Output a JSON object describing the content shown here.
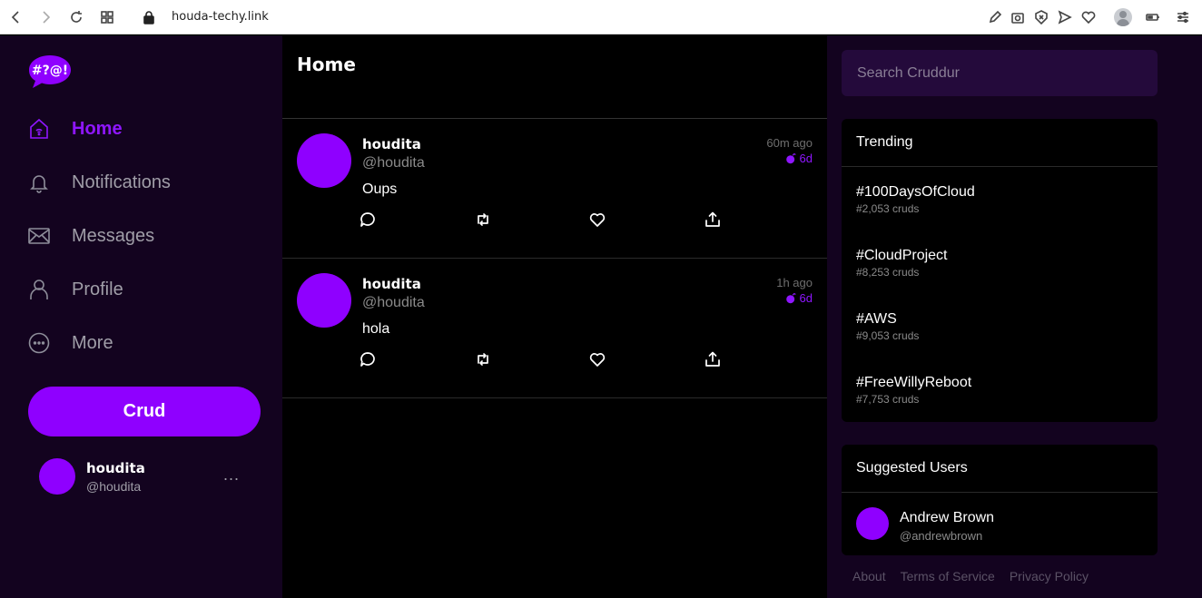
{
  "browser": {
    "url": "houda-techy.link"
  },
  "brand": {
    "logo_text": "#?@!",
    "accent": "#8f00ff"
  },
  "nav": {
    "items": [
      {
        "label": "Home",
        "icon": "home-icon",
        "active": true
      },
      {
        "label": "Notifications",
        "icon": "bell-icon"
      },
      {
        "label": "Messages",
        "icon": "envelope-icon"
      },
      {
        "label": "Profile",
        "icon": "user-icon"
      },
      {
        "label": "More",
        "icon": "more-circle-icon"
      }
    ],
    "crud_button": "Crud",
    "current_user": {
      "name": "houdita",
      "handle": "@houdita",
      "menu": "..."
    }
  },
  "feed": {
    "title": "Home",
    "posts": [
      {
        "name": "houdita",
        "handle": "@houdita",
        "text": "Oups",
        "time": "60m ago",
        "expires": "6d"
      },
      {
        "name": "houdita",
        "handle": "@houdita",
        "text": "hola",
        "time": "1h ago",
        "expires": "6d"
      }
    ]
  },
  "sidebar": {
    "search_placeholder": "Search Cruddur",
    "trending_title": "Trending",
    "trends": [
      {
        "name": "#100DaysOfCloud",
        "count": "#2,053 cruds"
      },
      {
        "name": "#CloudProject",
        "count": "#8,253 cruds"
      },
      {
        "name": "#AWS",
        "count": "#9,053 cruds"
      },
      {
        "name": "#FreeWillyReboot",
        "count": "#7,753 cruds"
      }
    ],
    "suggested_title": "Suggested Users",
    "suggested": [
      {
        "name": "Andrew Brown",
        "handle": "@andrewbrown"
      }
    ],
    "footer": [
      "About",
      "Terms of Service",
      "Privacy Policy"
    ]
  }
}
